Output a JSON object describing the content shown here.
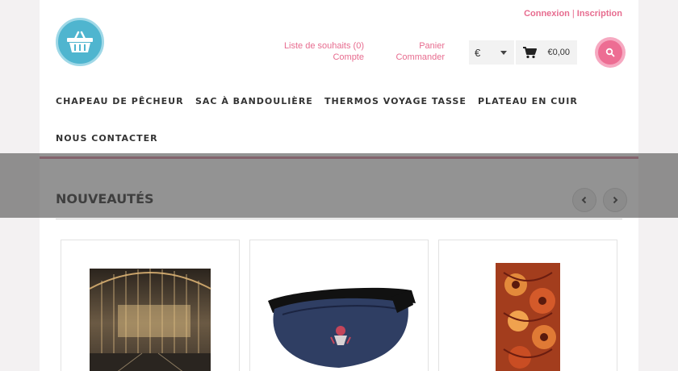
{
  "header": {
    "login_label": "Connexion",
    "separator": "|",
    "signup_label": "Inscription",
    "wishlist_label": "Liste de souhaits (0)",
    "account_label": "Compte",
    "cart_link_label": "Panier",
    "checkout_label": "Commander",
    "currency_value": "€",
    "cart_total": "€0,00"
  },
  "nav": {
    "items": [
      {
        "label": "CHAPEAU DE PÊCHEUR"
      },
      {
        "label": "SAC À BANDOULIÈRE"
      },
      {
        "label": "THERMOS VOYAGE TASSE"
      },
      {
        "label": "PLATEAU EN CUIR"
      },
      {
        "label": "NOUS CONTACTER"
      }
    ]
  },
  "section": {
    "title": "NOUVEAUTÉS"
  },
  "colors": {
    "accent": "#e76c8f",
    "logo": "#4fb5cf",
    "search": "#ed6d93"
  },
  "icons": [
    "basket-logo-icon",
    "cart-icon",
    "search-icon",
    "chevron-left-icon",
    "chevron-right-icon"
  ]
}
